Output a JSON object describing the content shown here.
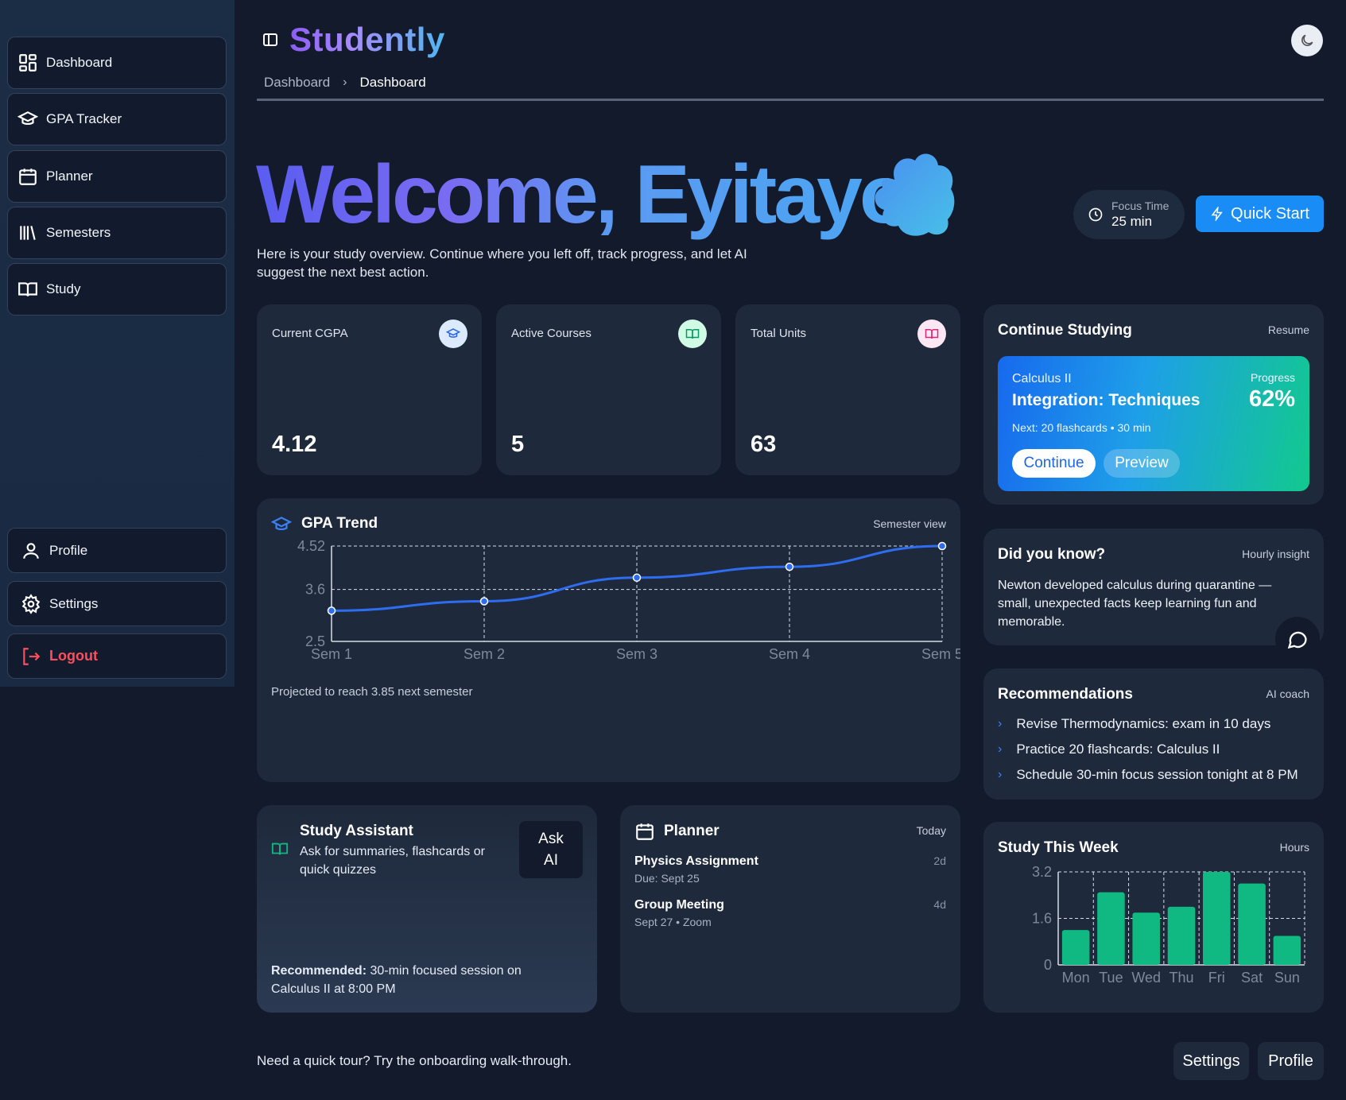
{
  "sidebar": {
    "items": [
      {
        "label": "Dashboard",
        "icon": "dashboard-icon"
      },
      {
        "label": "GPA Tracker",
        "icon": "graduation-cap-icon"
      },
      {
        "label": "Planner",
        "icon": "calendar-icon"
      },
      {
        "label": "Semesters",
        "icon": "library-icon"
      },
      {
        "label": "Study",
        "icon": "book-open-icon"
      }
    ],
    "bottom_items": [
      {
        "label": "Profile",
        "icon": "user-icon"
      },
      {
        "label": "Settings",
        "icon": "gear-icon"
      },
      {
        "label": "Logout",
        "icon": "logout-icon"
      }
    ]
  },
  "header": {
    "brand": "Studently",
    "breadcrumb": [
      "Dashboard",
      "Dashboard"
    ]
  },
  "hero": {
    "welcome": "Welcome, Eyitayo",
    "subtitle": "Here is your study overview. Continue where you left off, track progress, and let AI suggest the next best action.",
    "focus_label": "Focus Time",
    "focus_value": "25 min",
    "quick_start": "Quick Start"
  },
  "stats": [
    {
      "label": "Current CGPA",
      "value": "4.12",
      "icon": "graduation-cap-icon"
    },
    {
      "label": "Active Courses",
      "value": "5",
      "icon": "book-open-icon"
    },
    {
      "label": "Total Units",
      "value": "63",
      "icon": "book-open-icon"
    }
  ],
  "continue": {
    "title": "Continue Studying",
    "meta": "Resume",
    "course": "Calculus II",
    "topic": "Integration: Techniques",
    "next": "Next: 20 flashcards • 30 min",
    "progress_label": "Progress",
    "progress_value": "62%",
    "continue_btn": "Continue",
    "preview_btn": "Preview"
  },
  "did_you_know": {
    "title": "Did you know?",
    "meta": "Hourly insight",
    "text": "Newton developed calculus during quarantine — small, unexpected facts keep learning fun and memorable."
  },
  "recommendations": {
    "title": "Recommendations",
    "meta": "AI coach",
    "items": [
      "Revise Thermodynamics: exam in 10 days",
      "Practice 20 flashcards: Calculus II",
      "Schedule 30-min focus session tonight at 8 PM"
    ]
  },
  "gpa_trend": {
    "title": "GPA Trend",
    "meta": "Semester view",
    "footnote": "Projected to reach 3.85 next semester"
  },
  "study_assistant": {
    "title": "Study Assistant",
    "desc": "Ask for summaries, flashcards or quick quizzes",
    "ask_line1": "Ask",
    "ask_line2": "AI",
    "recommended_label": "Recommended:",
    "recommended_text": " 30-min focused session on Calculus II at 8:00 PM"
  },
  "planner": {
    "title": "Planner",
    "meta": "Today",
    "items": [
      {
        "title": "Physics Assignment",
        "sub": "Due: Sept 25",
        "badge": "2d"
      },
      {
        "title": "Group Meeting",
        "sub": "Sept 27 • Zoom",
        "badge": "4d"
      }
    ]
  },
  "study_week": {
    "title": "Study This Week",
    "meta": "Hours"
  },
  "footer": {
    "tour_text": "Need a quick tour? Try the onboarding walk-through.",
    "settings_btn": "Settings",
    "profile_btn": "Profile"
  },
  "colors": {
    "accent_blue": "#3b82f6",
    "accent_green": "#10b981",
    "logout_red": "#ff4d5b",
    "background": "#121a2c",
    "card": "#1e293b"
  },
  "chart_data": [
    {
      "type": "line",
      "categories": [
        "Sem 1",
        "Sem 2",
        "Sem 3",
        "Sem 4",
        "Sem 5"
      ],
      "series": [
        {
          "values": [
            3.15,
            3.35,
            3.85,
            4.08,
            4.52
          ]
        }
      ],
      "yticks": [
        "4.52",
        "3.6",
        "2.5"
      ],
      "ylim": [
        2.5,
        4.52
      ],
      "grid": true
    },
    {
      "type": "bar",
      "categories": [
        "Mon",
        "Tue",
        "Wed",
        "Thu",
        "Fri",
        "Sat",
        "Sun"
      ],
      "values": [
        1.2,
        2.5,
        1.8,
        2.0,
        3.2,
        2.8,
        1.0
      ],
      "yticks": [
        "3.2",
        "1.6",
        "0"
      ],
      "ylim": [
        0,
        3.2
      ],
      "grid": true
    }
  ]
}
